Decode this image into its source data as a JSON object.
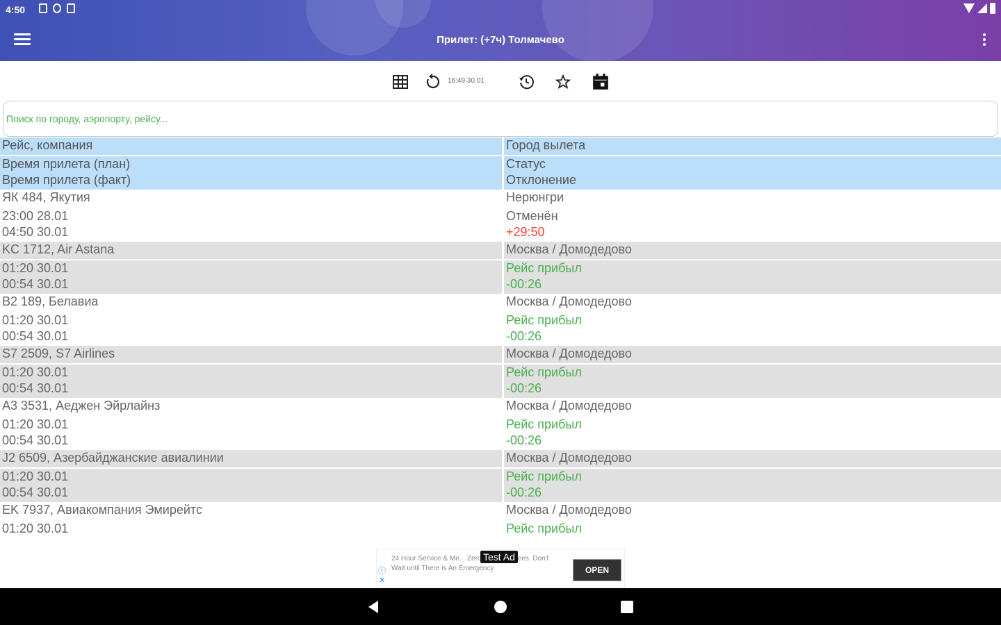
{
  "status_bar": {
    "time": "4:50"
  },
  "app_bar": {
    "title": "Прилет: (+7ч) Толмачево"
  },
  "action_bar": {
    "timestamp": "16:49 30.01"
  },
  "search": {
    "placeholder": "Поиск по городу, аэропорту, рейсу..."
  },
  "table": {
    "headers": {
      "flight": "Рейс, компания",
      "city": "Город вылета",
      "time_plan": "Время прилета (план)",
      "status": "Статус",
      "time_fact": "Время прилета (факт)",
      "deviation": "Отклонение"
    },
    "rows": [
      {
        "flight": "ЯК 484, Якутия",
        "city": "Нерюнгри",
        "plan": "23:00 28.01",
        "status": "Отменён",
        "fact": "04:50 30.01",
        "deviation": "+29:50"
      },
      {
        "flight": "KC 1712, Air Astana",
        "city": "Москва / Домодедово",
        "plan": "01:20 30.01",
        "status": "Рейс прибыл",
        "fact": "00:54 30.01",
        "deviation": "-00:26"
      },
      {
        "flight": "B2 189, Белавиа",
        "city": "Москва / Домодедово",
        "plan": "01:20 30.01",
        "status": "Рейс прибыл",
        "fact": "00:54 30.01",
        "deviation": "-00:26"
      },
      {
        "flight": "S7 2509, S7 Airlines",
        "city": "Москва / Домодедово",
        "plan": "01:20 30.01",
        "status": "Рейс прибыл",
        "fact": "00:54 30.01",
        "deviation": "-00:26"
      },
      {
        "flight": "A3 3531, Аеджен Эйрлайнз",
        "city": "Москва / Домодедово",
        "plan": "01:20 30.01",
        "status": "Рейс прибыл",
        "fact": "00:54 30.01",
        "deviation": "-00:26"
      },
      {
        "flight": "J2 6509, Азербайджанские авиалинии",
        "city": "Москва / Домодедово",
        "plan": "01:20 30.01",
        "status": "Рейс прибыл",
        "fact": "00:54 30.01",
        "deviation": "-00:26"
      },
      {
        "flight": "EK 7937, Авиакомпания Эмирейтс",
        "city": "Москва / Домодедово",
        "plan": "01:20 30.01",
        "status": "Рейс прибыл"
      }
    ]
  },
  "ad": {
    "badge": "Test Ad",
    "text": "24 Hour Service & Me... Zero Overtime Fees. Don't Wait until There is An Emergency",
    "open_label": "OPEN"
  },
  "colors": {
    "accent_start": "#3f51b5",
    "accent_end": "#7b3fa8",
    "header_bg": "#bbdefb",
    "status_green": "#4caf50",
    "deviation_red": "#f44336"
  }
}
